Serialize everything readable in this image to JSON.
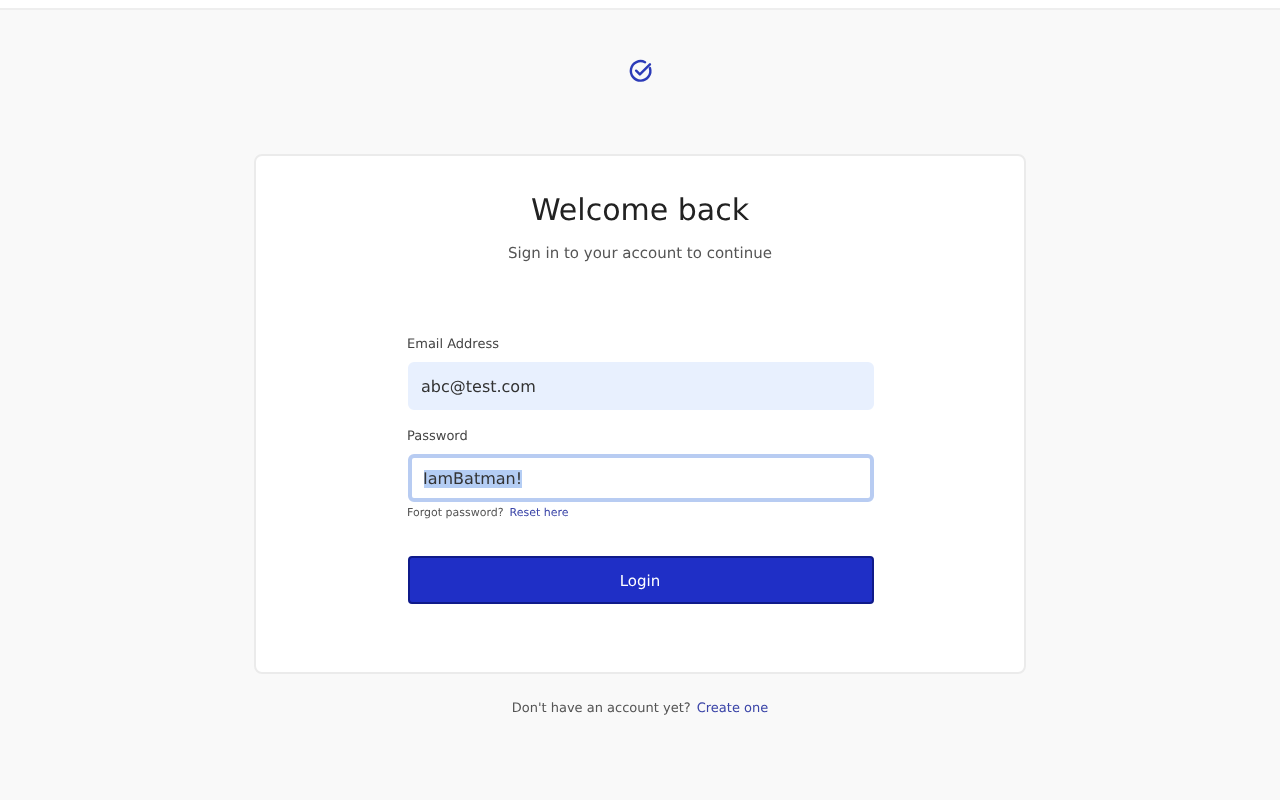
{
  "header": {
    "title": "Welcome back",
    "subtitle": "Sign in to your account to continue"
  },
  "fields": [
    {
      "label": "Email Address",
      "value": "abc@test.com",
      "autofilled": true,
      "focused": false,
      "text_selected": false
    },
    {
      "label": "Password",
      "value": "IamBatman!",
      "autofilled": false,
      "focused": true,
      "text_selected": true
    }
  ],
  "forgot": {
    "text": "Forgot password?",
    "link": "Reset here"
  },
  "submit": "Login",
  "footer": {
    "text": "Don't have an account yet?",
    "link": "Create one"
  }
}
